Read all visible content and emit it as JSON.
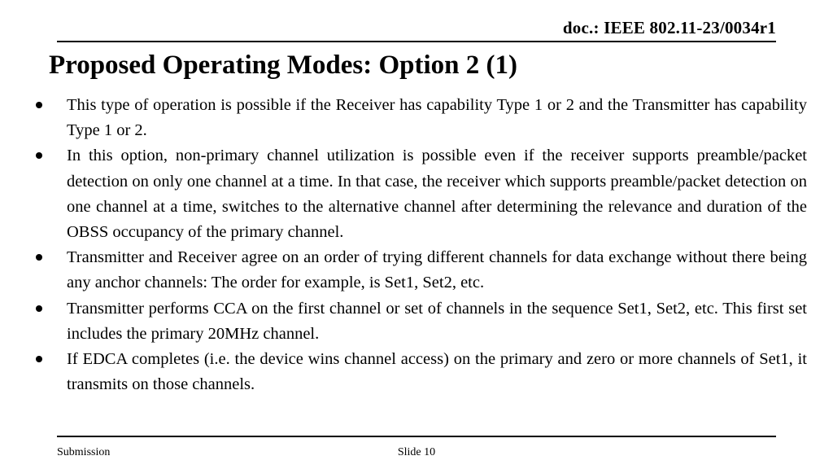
{
  "document": {
    "doc_reference": "doc.: IEEE 802.11-23/0034r1",
    "title": "Proposed Operating Modes: Option 2 (1)",
    "bullets": [
      "This type of operation is possible if the Receiver has capability Type 1 or 2 and the Transmitter has capability Type 1 or 2.",
      "In this option, non-primary channel utilization is possible even if the receiver supports preamble/packet detection on only one channel at a time. In that case, the receiver which supports preamble/packet detection on one channel at a time, switches to the alternative channel after determining the relevance and duration of the OBSS occupancy of the primary channel.",
      "Transmitter and Receiver agree on an order of trying different channels for data exchange without there being any anchor channels: The order for example, is Set1, Set2, etc.",
      "Transmitter performs CCA on the first channel or set of channels in the sequence Set1, Set2, etc. This first set includes the primary 20MHz channel.",
      "If EDCA completes (i.e. the device wins channel access) on the primary and zero or more channels of Set1, it transmits on those channels."
    ],
    "footer": {
      "left": "Submission",
      "center": "Slide 10"
    }
  }
}
